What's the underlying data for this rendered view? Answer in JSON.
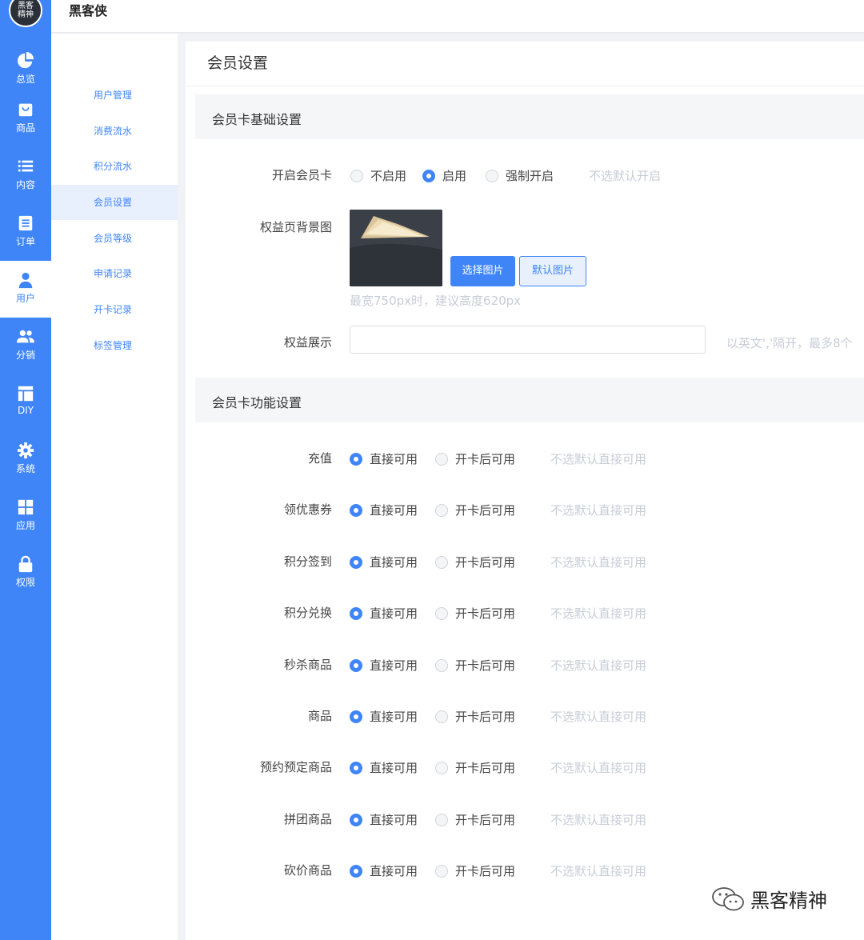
{
  "app": {
    "logo_text_1": "黑客",
    "logo_text_2": "精神",
    "brand": "黑客侠"
  },
  "rail": [
    {
      "label": "总览",
      "icon": "pie-chart-icon"
    },
    {
      "label": "商品",
      "icon": "shopping-bag-icon"
    },
    {
      "label": "内容",
      "icon": "list-icon"
    },
    {
      "label": "订单",
      "icon": "document-icon"
    },
    {
      "label": "用户",
      "icon": "user-icon"
    },
    {
      "label": "分销",
      "icon": "users-icon"
    },
    {
      "label": "DIY",
      "icon": "layout-icon"
    },
    {
      "label": "系统",
      "icon": "gear-icon"
    },
    {
      "label": "应用",
      "icon": "grid-icon"
    },
    {
      "label": "权限",
      "icon": "lock-icon"
    }
  ],
  "subnav": [
    "用户管理",
    "消费流水",
    "积分流水",
    "会员设置",
    "会员等级",
    "申请记录",
    "开卡记录",
    "标签管理"
  ],
  "page": {
    "title": "会员设置",
    "section_basic": "会员卡基础设置",
    "section_func": "会员卡功能设置"
  },
  "basic": {
    "enable_label": "开启会员卡",
    "enable_options": [
      "不启用",
      "启用",
      "强制开启"
    ],
    "enable_selected": "启用",
    "enable_hint": "不选默认开启",
    "bg_label": "权益页背景图",
    "choose_image": "选择图片",
    "default_image": "默认图片",
    "bg_hint": "最宽750px时，建议高度620px",
    "display_label": "权益展示",
    "display_value": "",
    "display_hint": "以英文','隔开，最多8个"
  },
  "func": {
    "option_direct": "直接可用",
    "option_after": "开卡后可用",
    "hint": "不选默认直接可用",
    "rows": [
      {
        "label": "充值",
        "selected": "直接可用"
      },
      {
        "label": "领优惠券",
        "selected": "直接可用"
      },
      {
        "label": "积分签到",
        "selected": "直接可用"
      },
      {
        "label": "积分兑换",
        "selected": "直接可用"
      },
      {
        "label": "秒杀商品",
        "selected": "直接可用"
      },
      {
        "label": "商品",
        "selected": "直接可用"
      },
      {
        "label": "预约预定商品",
        "selected": "直接可用"
      },
      {
        "label": "拼团商品",
        "selected": "直接可用"
      },
      {
        "label": "砍价商品",
        "selected": "直接可用"
      }
    ]
  },
  "watermark": {
    "text": "黑客精神",
    "icon": "wechat-icon"
  },
  "colors": {
    "accent": "#3f85f8",
    "hint": "#c7cdd6"
  }
}
